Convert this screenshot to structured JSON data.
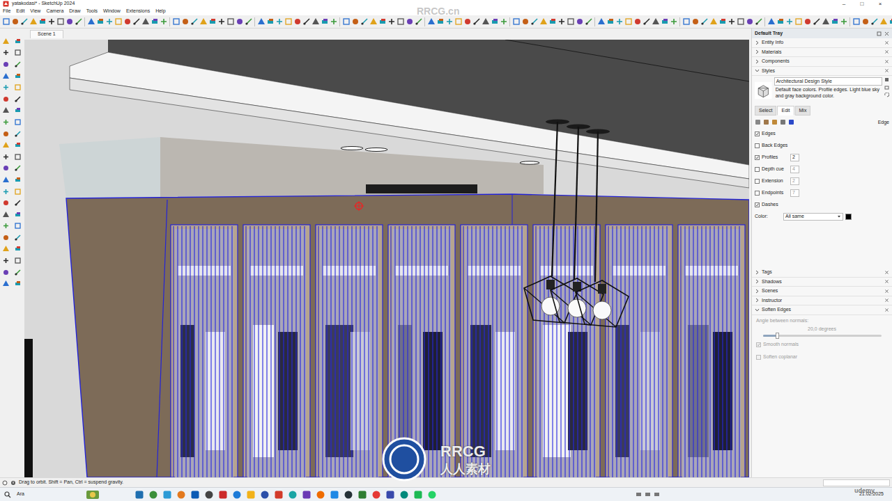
{
  "window": {
    "title": "yatakodasi* - SketchUp 2024",
    "controls": [
      "–",
      "□",
      "×"
    ]
  },
  "menu": [
    "File",
    "Edit",
    "View",
    "Camera",
    "Draw",
    "Tools",
    "Window",
    "Extensions",
    "Help"
  ],
  "scene_tabs": [
    {
      "label": "Scene 1",
      "selected": true
    }
  ],
  "tray": {
    "title": "Default Tray",
    "sections": [
      {
        "label": "Entity Info",
        "expanded": false
      },
      {
        "label": "Materials",
        "expanded": false
      },
      {
        "label": "Components",
        "expanded": false
      },
      {
        "label": "Styles",
        "expanded": true
      }
    ],
    "styles": {
      "name": "Architectural Design Style",
      "description": "Default face colors. Profile edges. Light blue sky and gray background color.",
      "tabs": [
        {
          "label": "Select",
          "selected": false
        },
        {
          "label": "Edit",
          "selected": true
        },
        {
          "label": "Mix",
          "selected": false
        }
      ],
      "panel_label": "Edge",
      "settings": [
        {
          "label": "Edges",
          "checked": true
        },
        {
          "label": "Back Edges",
          "checked": false
        },
        {
          "label": "Profiles",
          "checked": true,
          "value": "2"
        },
        {
          "label": "Depth cue",
          "checked": false,
          "value": "4"
        },
        {
          "label": "Extension",
          "checked": false,
          "value": "2"
        },
        {
          "label": "Endpoints",
          "checked": false,
          "value": "7"
        },
        {
          "label": "Dashes",
          "checked": true
        }
      ],
      "color": {
        "label": "Color:",
        "value": "All same",
        "swatch": "#000000"
      }
    },
    "lower_sections": [
      {
        "label": "Tags",
        "expanded": false
      },
      {
        "label": "Shadows",
        "expanded": false
      },
      {
        "label": "Scenes",
        "expanded": false
      },
      {
        "label": "Instructor",
        "expanded": false
      },
      {
        "label": "Soften Edges",
        "expanded": true
      }
    ],
    "soften": {
      "angle_label": "Angle between normals:",
      "angle_reading": "20,0 degrees",
      "level": 0.12,
      "options": [
        {
          "label": "Smooth normals",
          "checked": true,
          "disabled": true
        },
        {
          "label": "Soften coplanar",
          "checked": false,
          "disabled": true
        }
      ]
    }
  },
  "status_bar": {
    "text": "Drag to orbit. Shift = Pan, Ctrl = suspend gravity."
  },
  "taskbar": {
    "search": "Ara",
    "date": "21.02.2025"
  },
  "watermarks": {
    "top": "RRCG.cn",
    "logo": "RRCG",
    "logo_cn": "人人素材",
    "corner": "udemy"
  }
}
